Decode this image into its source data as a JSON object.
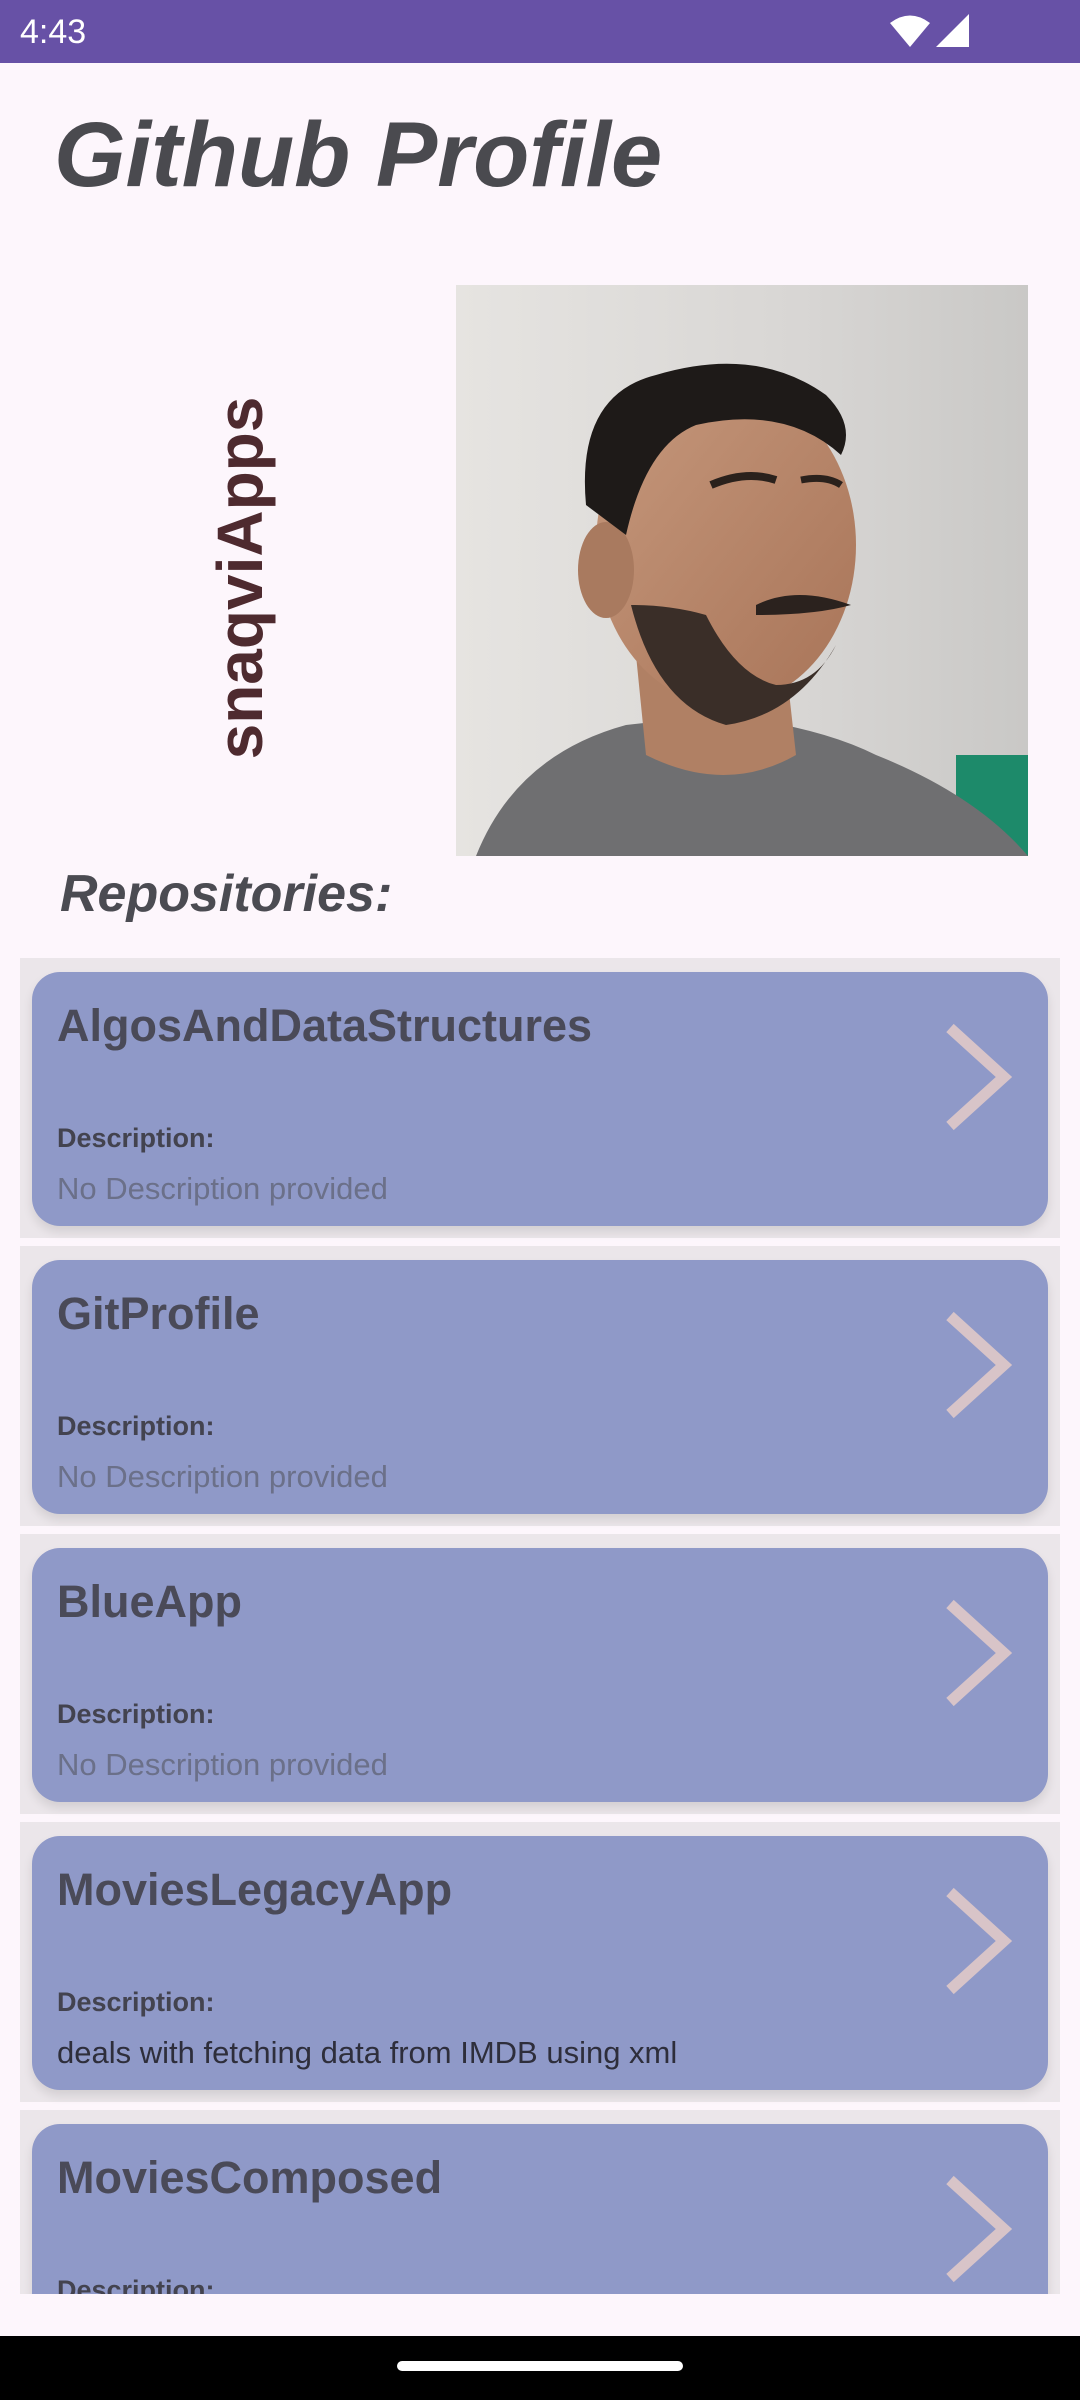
{
  "status_bar": {
    "time": "4:43",
    "icons": [
      "wifi-icon",
      "signal-icon"
    ]
  },
  "header": {
    "title": "Github Profile"
  },
  "profile": {
    "username": "snaqviApps",
    "avatar_desc": "profile photo"
  },
  "repositories": {
    "heading": "Repositories:",
    "items": [
      {
        "name": "AlgosAndDataStructures",
        "desc_label": "Description:",
        "desc": "No Description provided"
      },
      {
        "name": "GitProfile",
        "desc_label": "Description:",
        "desc": "No Description provided"
      },
      {
        "name": "BlueApp",
        "desc_label": "Description:",
        "desc": "No Description provided"
      },
      {
        "name": "MoviesLegacyApp",
        "desc_label": "Description:",
        "desc": "deals with fetching data from IMDB using xml"
      },
      {
        "name": "MoviesComposed",
        "desc_label": "Description:",
        "desc": ""
      }
    ]
  },
  "colors": {
    "status_bar": "#6751a6",
    "background": "#fdf6fc",
    "card": "#8f99c8",
    "chevron": "#d8c4c8",
    "username": "#4e2a2f"
  }
}
